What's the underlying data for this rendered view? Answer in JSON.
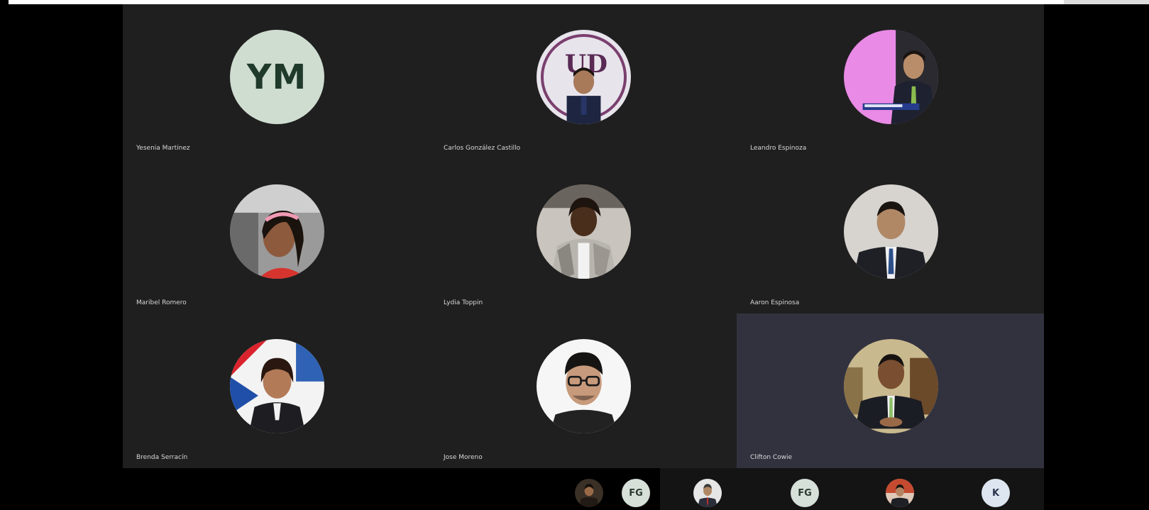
{
  "participants": [
    {
      "name": "Yesenia Martinez",
      "initials": "YM",
      "avatar": "initials"
    },
    {
      "name": "Carlos González Castillo",
      "avatar": "photo-man-logo-bg"
    },
    {
      "name": "Leandro Espinoza",
      "avatar": "photo-man-pink-bg"
    },
    {
      "name": "Maribel Romero",
      "avatar": "photo-woman-car"
    },
    {
      "name": "Lydia Toppin",
      "avatar": "photo-woman-blazer"
    },
    {
      "name": "Aaron Espinosa",
      "avatar": "photo-man-suit"
    },
    {
      "name": "Brenda Serracín",
      "avatar": "photo-woman-flag"
    },
    {
      "name": "Jose Moreno",
      "avatar": "photo-man-glasses"
    },
    {
      "name": "Clifton Cowie",
      "avatar": "photo-man-office"
    }
  ],
  "strip": [
    {
      "type": "photo",
      "avatar": "photo-man-dark"
    },
    {
      "type": "initials",
      "initials": "FG"
    },
    {
      "type": "photo",
      "avatar": "photo-man-portrait"
    },
    {
      "type": "initials",
      "initials": "FG"
    },
    {
      "type": "photo",
      "avatar": "photo-man-red"
    },
    {
      "type": "initials",
      "initials": "K"
    }
  ],
  "colors": {
    "tile_bg": "#1f1f1f",
    "active_tile_bg": "#32323f",
    "initials_bg": "#cfddd1"
  }
}
